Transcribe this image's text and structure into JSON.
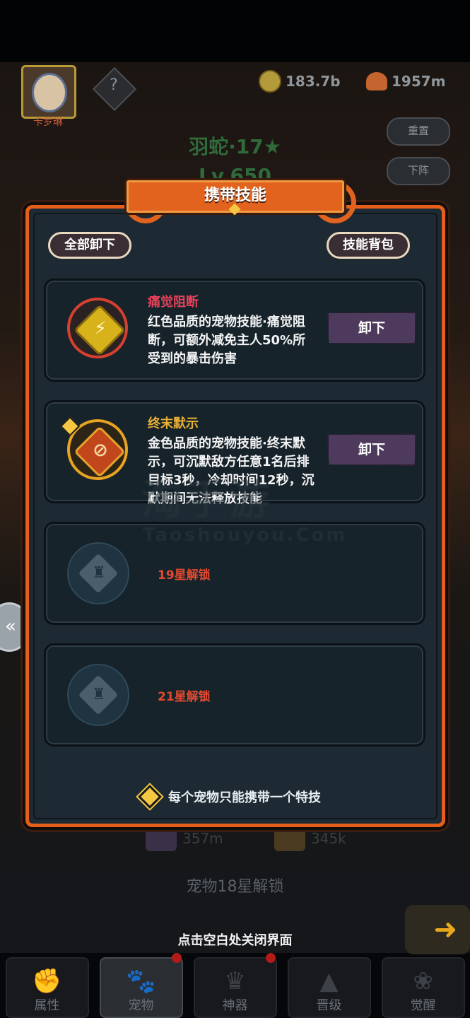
{
  "header": {
    "character_name": "卡罗琳",
    "locked_slot_symbol": "?",
    "gold_amount": "183.7b",
    "mushroom_amount": "1957m",
    "reset_label": "重置",
    "unequip_label": "下阵"
  },
  "pet": {
    "name": "羽蛇·17★",
    "level": "Lv.650"
  },
  "modal": {
    "title": "携带技能",
    "unload_all_label": "全部卸下",
    "skill_bag_label": "技能背包",
    "skills": [
      {
        "name": "痛觉阻断",
        "name_color": "#e8425a",
        "description": "红色品质的宠物技能·痛觉阻断，可额外减免主人50%所受到的暴击伤害",
        "button_label": "卸下",
        "quality": "red"
      },
      {
        "name": "终末默示",
        "name_color": "#e8b034",
        "description": "金色品质的宠物技能·终末默示，可沉默敌方任意1名后排目标3秒，冷却时间12秒，沉默期间无法释放技能",
        "button_label": "卸下",
        "quality": "gold"
      }
    ],
    "locked_slots": [
      {
        "unlock_text": "19星解锁"
      },
      {
        "unlock_text": "21星解锁"
      }
    ],
    "note": "每个宠物只能携带一个特技"
  },
  "background": {
    "pet_unlock_text": "宠物18星解锁",
    "ghost_res_1": "357m",
    "ghost_res_2": "345k"
  },
  "watermark": {
    "line1": "淘手游",
    "line2": "Taoshouyou.Com"
  },
  "close_hint": "点击空白处关闭界面",
  "nav": [
    {
      "label": "属性",
      "icon": "fist-icon"
    },
    {
      "label": "宠物",
      "icon": "paw-icon"
    },
    {
      "label": "神器",
      "icon": "crown-icon"
    },
    {
      "label": "晋级",
      "icon": "wing-icon"
    },
    {
      "label": "觉醒",
      "icon": "lotus-icon"
    }
  ],
  "colors": {
    "modal_border": "#e55f1b",
    "button_purple": "#4e3a5c",
    "unlock_red": "#e14a2e"
  }
}
